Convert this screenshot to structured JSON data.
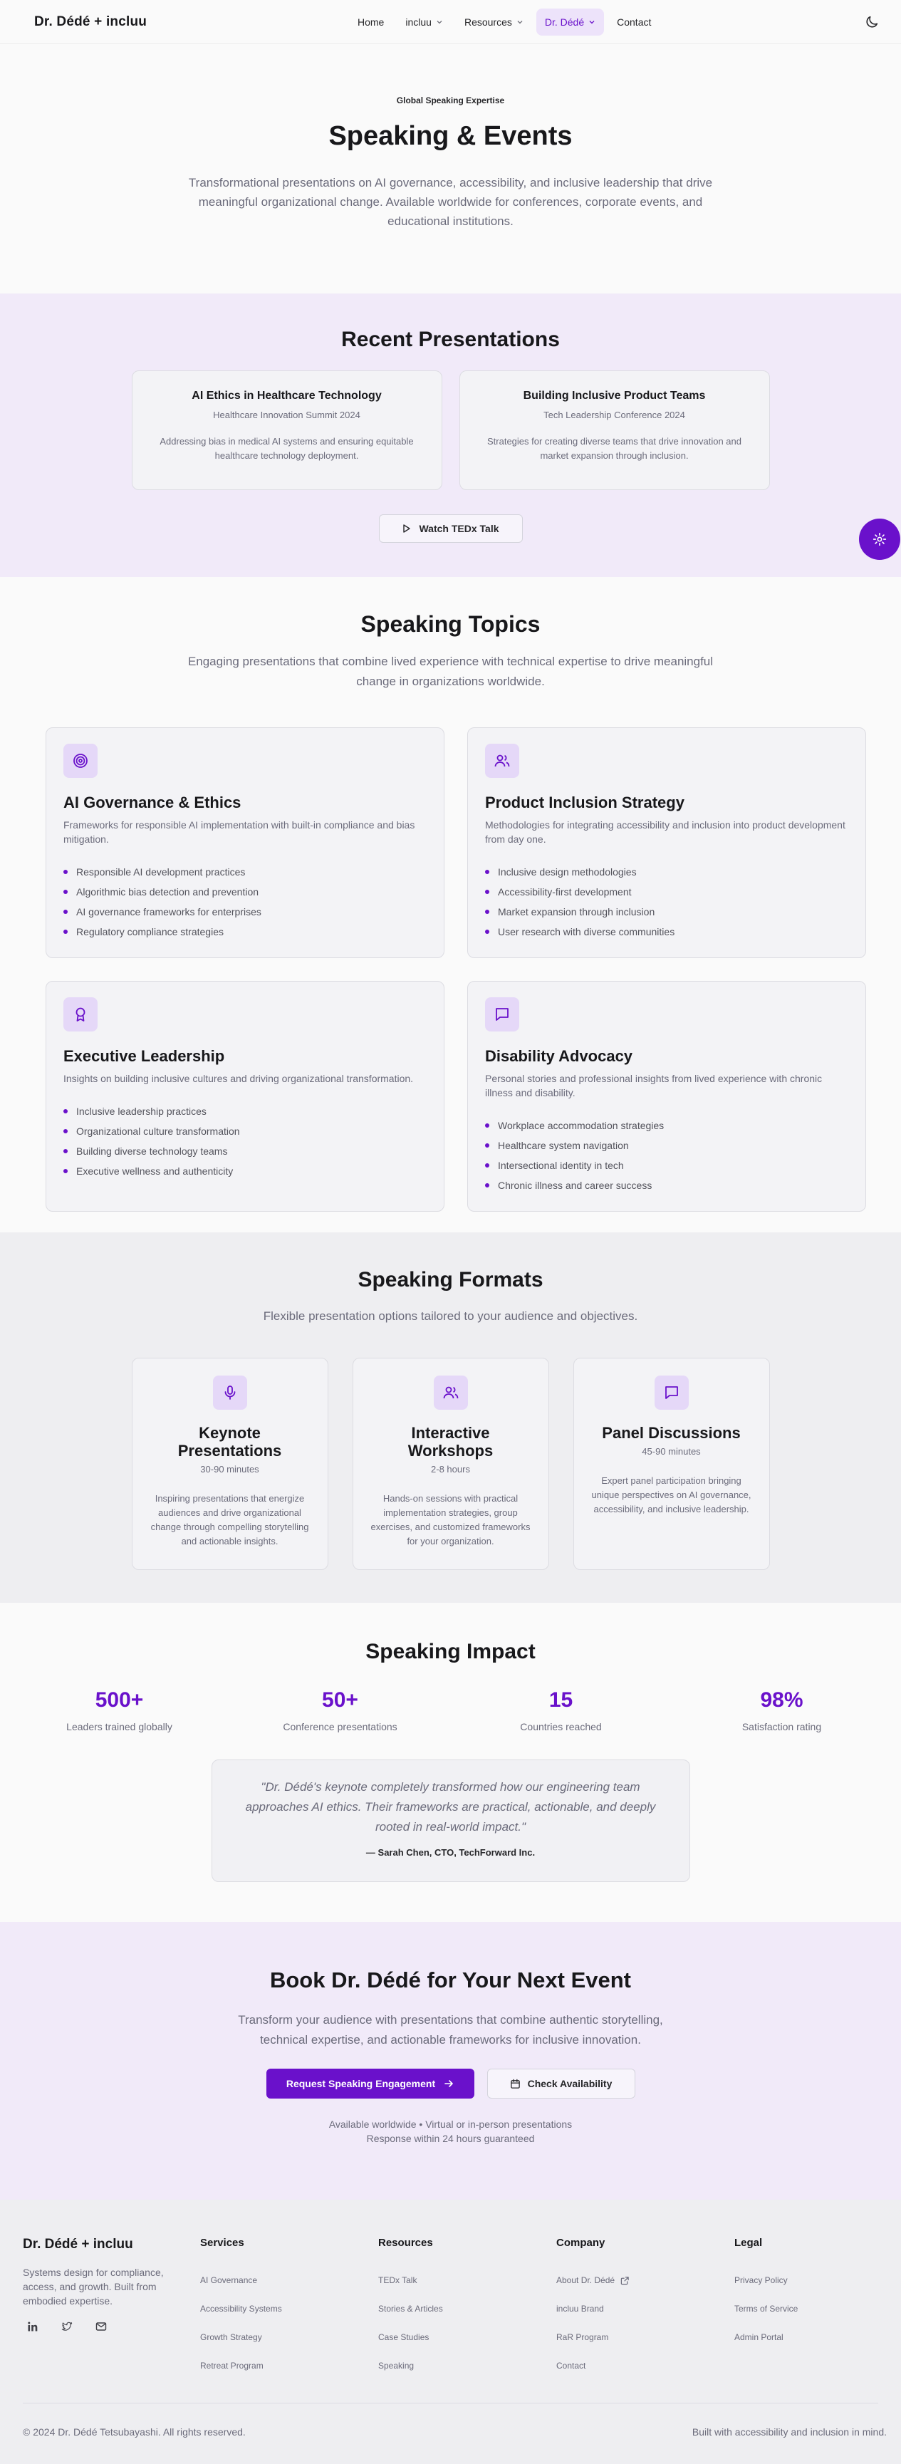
{
  "nav": {
    "brand": "Dr. Dédé + incluu",
    "links": [
      {
        "label": "Home",
        "dropdown": false,
        "active": false
      },
      {
        "label": "incluu",
        "dropdown": true,
        "active": false
      },
      {
        "label": "Resources",
        "dropdown": true,
        "active": false
      },
      {
        "label": "Dr. Dédé",
        "dropdown": true,
        "active": true
      },
      {
        "label": "Contact",
        "dropdown": false,
        "active": false
      }
    ],
    "theme_icon": "moon-icon"
  },
  "hero": {
    "eyebrow": "Global Speaking Expertise",
    "title": "Speaking & Events",
    "description": "Transformational presentations on AI governance, accessibility, and inclusive leadership that drive meaningful organizational change. Available worldwide for conferences, corporate events, and educational institutions."
  },
  "recent": {
    "title": "Recent Presentations",
    "cards": [
      {
        "title": "AI Ethics in Healthcare Technology",
        "event": "Healthcare Innovation Summit 2024",
        "description": "Addressing bias in medical AI systems and ensuring equitable healthcare technology deployment."
      },
      {
        "title": "Building Inclusive Product Teams",
        "event": "Tech Leadership Conference 2024",
        "description": "Strategies for creating diverse teams that drive innovation and market expansion through inclusion."
      }
    ],
    "ted_button": "Watch TEDx Talk"
  },
  "topics": {
    "title": "Speaking Topics",
    "lead": "Engaging presentations that combine lived experience with technical expertise to drive meaningful change in organizations worldwide.",
    "cards": [
      {
        "icon": "target-icon",
        "title": "AI Governance & Ethics",
        "description": "Frameworks for responsible AI implementation with built-in compliance and bias mitigation.",
        "items": [
          "Responsible AI development practices",
          "Algorithmic bias detection and prevention",
          "AI governance frameworks for enterprises",
          "Regulatory compliance strategies"
        ]
      },
      {
        "icon": "users-icon",
        "title": "Product Inclusion Strategy",
        "description": "Methodologies for integrating accessibility and inclusion into product development from day one.",
        "items": [
          "Inclusive design methodologies",
          "Accessibility-first development",
          "Market expansion through inclusion",
          "User research with diverse communities"
        ]
      },
      {
        "icon": "award-icon",
        "title": "Executive Leadership",
        "description": "Insights on building inclusive cultures and driving organizational transformation.",
        "items": [
          "Inclusive leadership practices",
          "Organizational culture transformation",
          "Building diverse technology teams",
          "Executive wellness and authenticity"
        ]
      },
      {
        "icon": "message-square-icon",
        "title": "Disability Advocacy",
        "description": "Personal stories and professional insights from lived experience with chronic illness and disability.",
        "items": [
          "Workplace accommodation strategies",
          "Healthcare system navigation",
          "Intersectional identity in tech",
          "Chronic illness and career success"
        ]
      }
    ]
  },
  "formats": {
    "title": "Speaking Formats",
    "lead": "Flexible presentation options tailored to your audience and objectives.",
    "cards": [
      {
        "icon": "mic-icon",
        "title": "Keynote Presentations",
        "duration": "30-90 minutes",
        "description": "Inspiring presentations that energize audiences and drive organizational change through compelling storytelling and actionable insights."
      },
      {
        "icon": "users-icon",
        "title": "Interactive Workshops",
        "duration": "2-8 hours",
        "description": "Hands-on sessions with practical implementation strategies, group exercises, and customized frameworks for your organization."
      },
      {
        "icon": "message-square-icon",
        "title": "Panel Discussions",
        "duration": "45-90 minutes",
        "description": "Expert panel participation bringing unique perspectives on AI governance, accessibility, and inclusive leadership."
      }
    ]
  },
  "impact": {
    "title": "Speaking Impact",
    "stats": [
      {
        "value": "500+",
        "label": "Leaders trained globally"
      },
      {
        "value": "50+",
        "label": "Conference presentations"
      },
      {
        "value": "15",
        "label": "Countries reached"
      },
      {
        "value": "98%",
        "label": "Satisfaction rating"
      }
    ],
    "quote": "\"Dr. Dédé's keynote completely transformed how our engineering team approaches AI ethics. Their frameworks are practical, actionable, and deeply rooted in real-world impact.\"",
    "attribution": "— Sarah Chen, CTO, TechForward Inc."
  },
  "book": {
    "title": "Book Dr. Dédé for Your Next Event",
    "lead": "Transform your audience with presentations that combine authentic storytelling, technical expertise, and actionable frameworks for inclusive innovation.",
    "primary_button": "Request Speaking Engagement",
    "secondary_button": "Check Availability",
    "availability": "Available worldwide • Virtual or in-person presentations",
    "response": "Response within 24 hours guaranteed"
  },
  "footer": {
    "brand": "Dr. Dédé + incluu",
    "tagline": "Systems design for compliance, access, and growth. Built from embodied expertise.",
    "socials": [
      "linkedin-icon",
      "twitter-icon",
      "mail-icon"
    ],
    "columns": [
      {
        "title": "Services",
        "links": [
          "AI Governance",
          "Accessibility Systems",
          "Growth Strategy",
          "Retreat Program"
        ]
      },
      {
        "title": "Resources",
        "links": [
          "TEDx Talk",
          "Stories & Articles",
          "Case Studies",
          "Speaking"
        ]
      },
      {
        "title": "Company",
        "links": [
          "About Dr. Dédé",
          "incluu Brand",
          "RaR Program",
          "Contact"
        ]
      },
      {
        "title": "Legal",
        "links": [
          "Privacy Policy",
          "Terms of Service",
          "Admin Portal"
        ]
      }
    ],
    "copyright": "© 2024 Dr. Dédé Tetsubayashi. All rights reserved.",
    "built_with": "Built with accessibility and inclusion in mind."
  },
  "colors": {
    "accent": "#6a11cb",
    "tint": "#f1eaf9",
    "icon_bg": "#e5d8f8"
  }
}
